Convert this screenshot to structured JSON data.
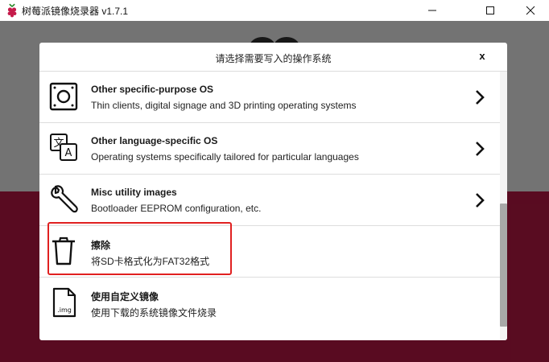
{
  "window": {
    "title": "树莓派镜像烧录器 v1.7.1",
    "icon": "raspberry-pi-logo",
    "controls": [
      "minimize-icon",
      "maximize-icon",
      "close-icon"
    ]
  },
  "colors": {
    "brand_red": "#c51a4a",
    "overlay": "rgba(0,0,0,0.55)",
    "highlight_border": "#e02020"
  },
  "dialog": {
    "title": "请选择需要写入的操作系统",
    "close_label": "x",
    "items": [
      {
        "title": "Other specific-purpose OS",
        "description": "Thin clients, digital signage and 3D printing operating systems",
        "icon": "specific-purpose-os-icon",
        "has_chevron": true
      },
      {
        "title": "Other language-specific OS",
        "description": "Operating systems specifically tailored for particular languages",
        "icon": "language-translate-icon",
        "has_chevron": true
      },
      {
        "title": "Misc utility images",
        "description": "Bootloader EEPROM configuration, etc.",
        "icon": "wrench-icon",
        "has_chevron": true
      },
      {
        "title": "擦除",
        "description": "将SD卡格式化为FAT32格式",
        "icon": "trash-icon",
        "has_chevron": false
      },
      {
        "title": "使用自定义镜像",
        "description": "使用下载的系统镜像文件烧录",
        "icon": "img-file-icon",
        "has_chevron": false
      }
    ]
  }
}
